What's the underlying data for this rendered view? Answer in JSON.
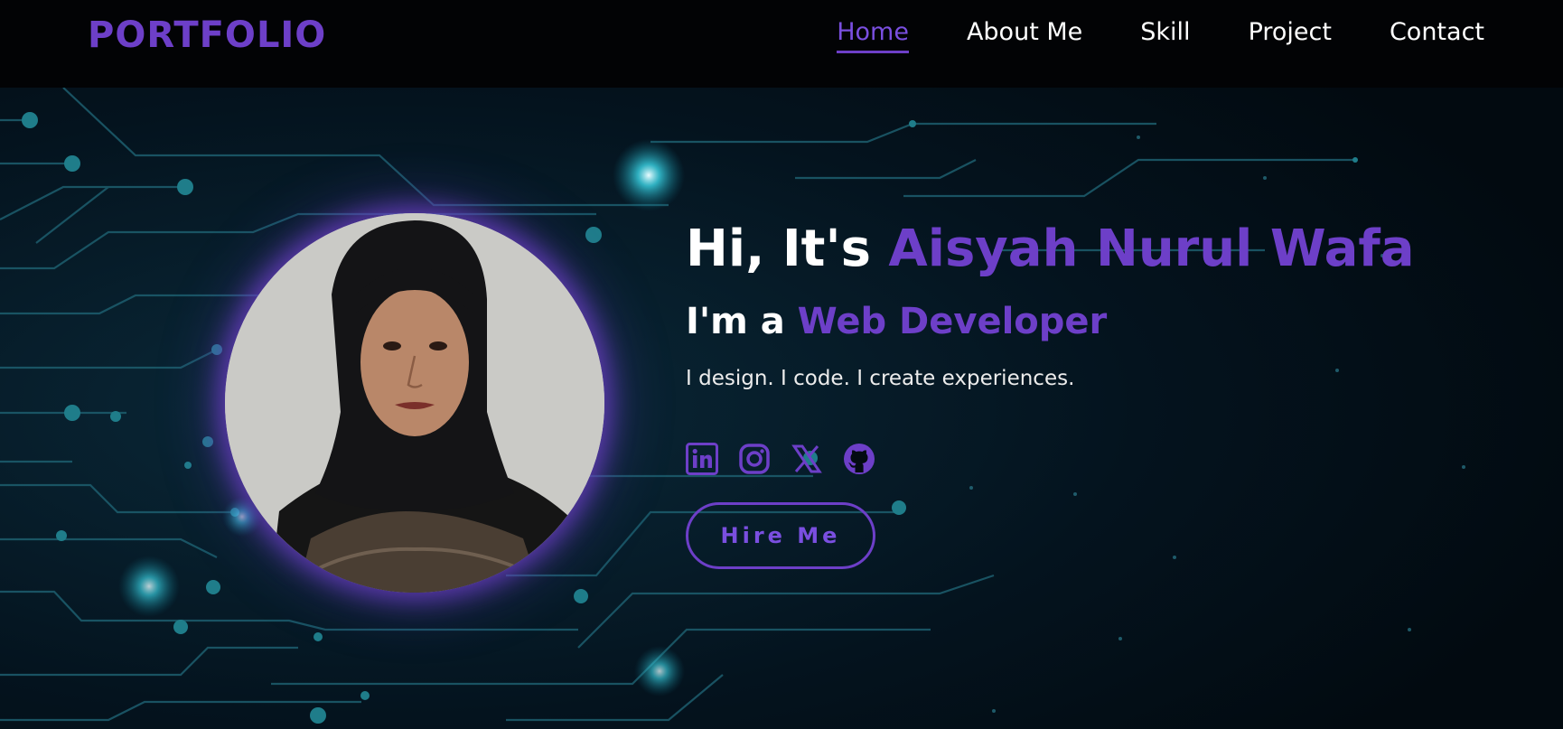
{
  "brand": {
    "logo": "PORTFOLIO",
    "accent_color": "#6d3fc8"
  },
  "nav": {
    "items": [
      {
        "label": "Home",
        "active": true
      },
      {
        "label": "About Me",
        "active": false
      },
      {
        "label": "Skill",
        "active": false
      },
      {
        "label": "Project",
        "active": false
      },
      {
        "label": "Contact",
        "active": false
      }
    ]
  },
  "hero": {
    "greeting": "Hi, It's ",
    "name": "Aisyah Nurul Wafa",
    "role_prefix": "I'm a ",
    "role": "Web Developer",
    "tagline": "I design. I code. I create experiences.",
    "socials": [
      "linkedin-icon",
      "instagram-icon",
      "x-icon",
      "github-icon"
    ],
    "cta_label": "Hire Me"
  }
}
